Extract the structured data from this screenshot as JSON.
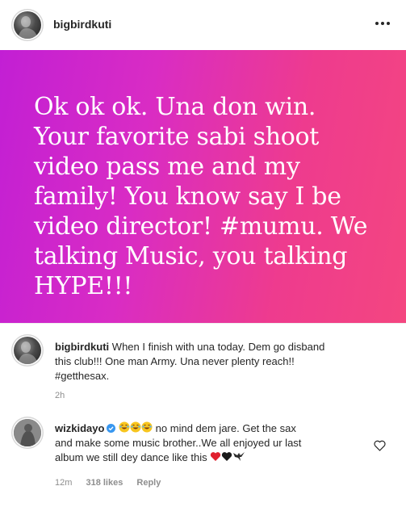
{
  "post": {
    "username": "bigbirdkuti",
    "image_text_lines": [
      "Ok ok ok. Una don win.",
      "Your favorite sabi shoot",
      "video pass me and my",
      "family! You know say I be",
      "video director! #mumu. We",
      "talking Music, you talking",
      "HYPE!!!"
    ],
    "background_colors": [
      "#c21fd4",
      "#f44680"
    ]
  },
  "comments": [
    {
      "username": "bigbirdkuti",
      "lines": [
        "When I finish with una today. Dem go disband",
        "this club!!! One man Army. Una never plenty reach!!",
        "#getthesax."
      ],
      "time": "2h"
    },
    {
      "username": "wizkidayo",
      "verified": true,
      "emojis_start": [
        "joy-emoji",
        "joy-emoji",
        "joy-emoji"
      ],
      "lines": [
        "no mind dem jare. Get the sax",
        "and make some music brother..We all enjoyed ur last",
        "album we still dey dance like this"
      ],
      "emojis_end": [
        "red-heart-emoji",
        "black-heart-emoji",
        "eagle-emoji"
      ],
      "time": "12m",
      "likes": "318 likes",
      "reply_label": "Reply"
    }
  ],
  "colors": {
    "text": "#262626",
    "muted": "#8e8e8e",
    "verified": "#3897f0"
  }
}
